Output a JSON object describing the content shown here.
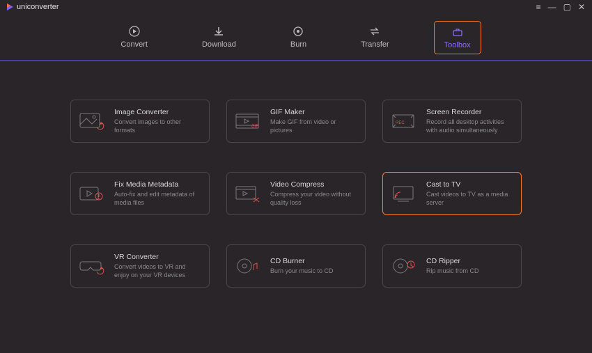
{
  "app": {
    "name": "uniconverter"
  },
  "nav": {
    "convert": "Convert",
    "download": "Download",
    "burn": "Burn",
    "transfer": "Transfer",
    "toolbox": "Toolbox"
  },
  "tools": {
    "imageConverter": {
      "title": "Image Converter",
      "desc": "Convert images to other formats"
    },
    "gifMaker": {
      "title": "GIF Maker",
      "desc": "Make GIF from video or pictures"
    },
    "screenRecorder": {
      "title": "Screen Recorder",
      "desc": "Record all desktop activities with audio simultaneously"
    },
    "fixMediaMetadata": {
      "title": "Fix Media Metadata",
      "desc": "Auto-fix and edit metadata of media files"
    },
    "videoCompress": {
      "title": "Video Compress",
      "desc": "Compress your video without quality loss"
    },
    "castToTv": {
      "title": "Cast to TV",
      "desc": "Cast videos to TV as a media server"
    },
    "vrConverter": {
      "title": "VR Converter",
      "desc": "Convert videos to VR and enjoy on your VR devices"
    },
    "cdBurner": {
      "title": "CD Burner",
      "desc": "Burn your music to CD"
    },
    "cdRipper": {
      "title": "CD Ripper",
      "desc": "Rip music from CD"
    }
  }
}
